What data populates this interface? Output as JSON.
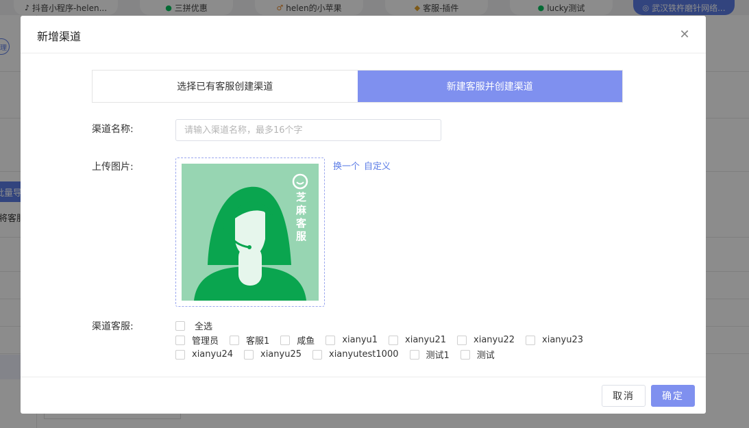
{
  "background": {
    "tabs": [
      {
        "label": "抖音小程序-helen...",
        "icon": "tiktok-icon"
      },
      {
        "label": "三拼优惠",
        "icon": "wechat-icon"
      },
      {
        "label": "helen的小苹果",
        "icon": "apple-icon"
      },
      {
        "label": "客服-插件",
        "icon": "cube-icon"
      },
      {
        "label": "lucky测试",
        "icon": "wechat-icon"
      },
      {
        "label": "武汉铁杵磨针网络...",
        "icon": "wechat-icon",
        "active": true
      }
    ],
    "side_button": "批量导",
    "side_text": "将客服",
    "circle_text": "理"
  },
  "dialog": {
    "title": "新增渠道",
    "segments": [
      {
        "label": "选择已有客服创建渠道",
        "active": false
      },
      {
        "label": "新建客服并创建渠道",
        "active": true
      }
    ],
    "name_label": "渠道名称:",
    "name_placeholder": "请输入渠道名称，最多16个字",
    "upload_label": "上传图片:",
    "upload_links": {
      "change": "换一个",
      "custom": "自定义"
    },
    "avatar_brand": "芝麻客服",
    "agents_label": "渠道客服:",
    "select_all": "全选",
    "agents_row1": [
      "管理员",
      "客服1",
      "咸鱼",
      "xianyu1",
      "xianyu21",
      "xianyu22",
      "xianyu23"
    ],
    "agents_row2": [
      "xianyu24",
      "xianyu25",
      "xianyutest1000",
      "测试1",
      "测试"
    ],
    "cancel": "取消",
    "ok": "确定"
  },
  "colors": {
    "accent": "#7f90ef",
    "link": "#5b7ce6",
    "avatar_bg": "#97d5b2",
    "avatar_green": "#0aa54f"
  }
}
